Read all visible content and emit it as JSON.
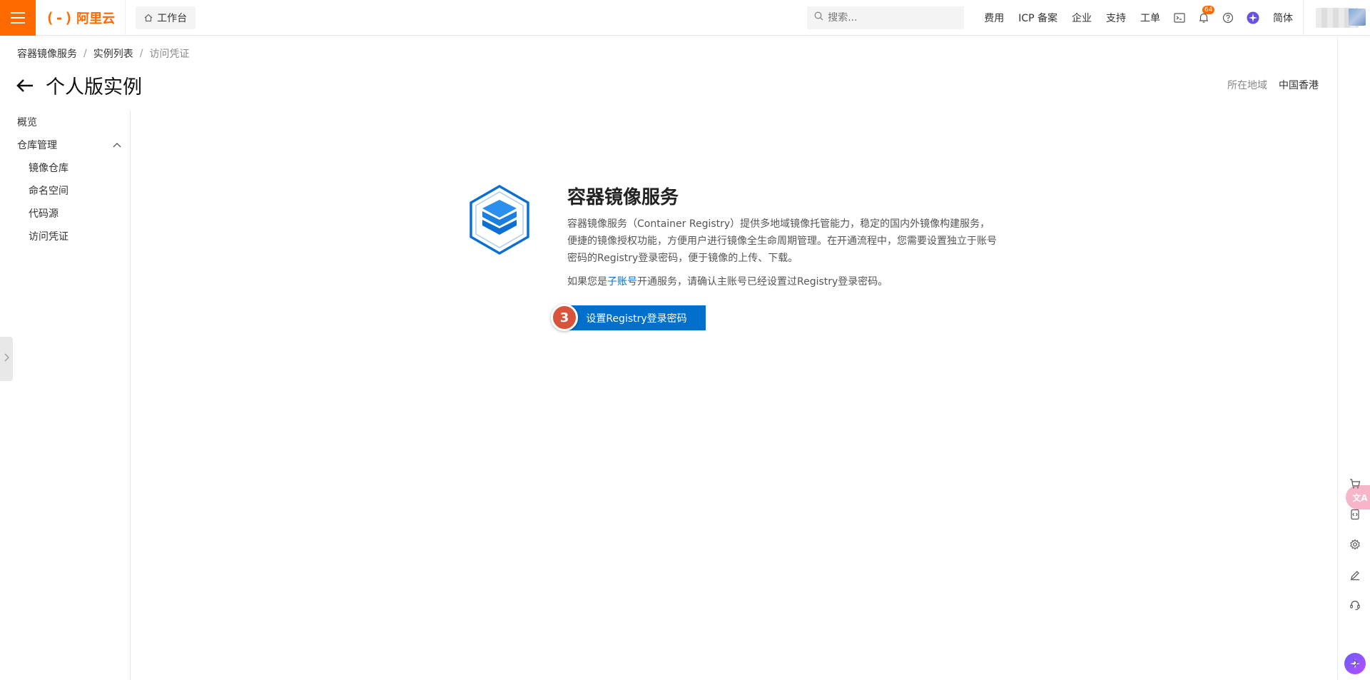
{
  "topbar": {
    "logo_mark": "(-)",
    "logo_text": "阿里云",
    "workbench_label": "工作台",
    "search_placeholder": "搜索...",
    "nav_links": [
      "费用",
      "ICP 备案",
      "企业",
      "支持",
      "工单"
    ],
    "notification_count": "64",
    "language": "简体",
    "brand_color": "#ff6a00"
  },
  "breadcrumb": {
    "items": [
      "容器镜像服务",
      "实例列表",
      "访问凭证"
    ],
    "separator": "/"
  },
  "page": {
    "title": "个人版实例",
    "region_label": "所在地域",
    "region_value": "中国香港"
  },
  "sidebar": {
    "overview": "概览",
    "repo_group": "仓库管理",
    "sub_items": [
      "镜像仓库",
      "命名空间",
      "代码源",
      "访问凭证"
    ]
  },
  "main": {
    "title": "容器镜像服务",
    "description": "容器镜像服务（Container Registry）提供多地域镜像托管能力，稳定的国内外镜像构建服务，便捷的镜像授权功能，方便用户进行镜像全生命周期管理。在开通流程中，您需要设置独立于账号密码的Registry登录密码，便于镜像的上传、下载。",
    "note_prefix": "如果您是",
    "note_link": "子账号",
    "note_suffix": "开通服务，请确认主账号已经设置过Registry登录密码。",
    "button_label": "设置Registry登录密码",
    "step_number": "3",
    "accent_color": "#0070cc"
  },
  "right_rail": {
    "translate_label": "文A"
  }
}
